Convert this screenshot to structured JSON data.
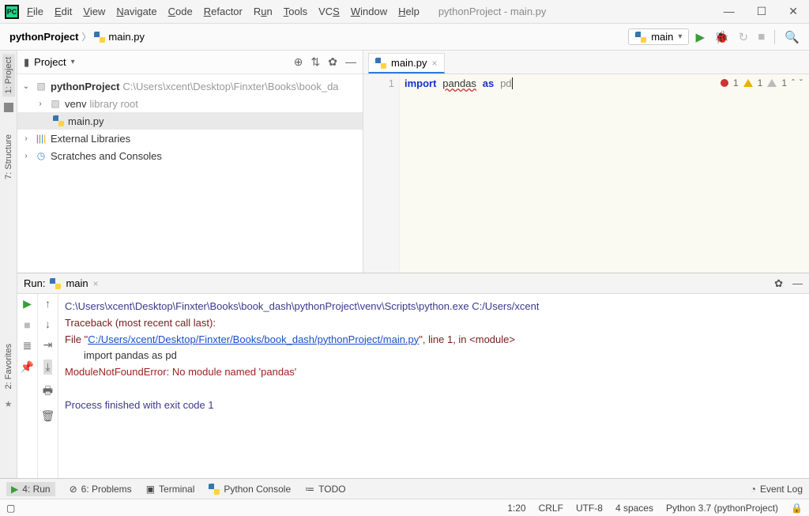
{
  "window": {
    "title": "pythonProject - main.py",
    "menus": [
      "File",
      "Edit",
      "View",
      "Navigate",
      "Code",
      "Refactor",
      "Run",
      "Tools",
      "VCS",
      "Window",
      "Help"
    ]
  },
  "breadcrumb": {
    "project": "pythonProject",
    "file": "main.py"
  },
  "run_config": {
    "label": "main"
  },
  "project_pane": {
    "title": "Project",
    "root": {
      "name": "pythonProject",
      "path": "C:\\Users\\xcent\\Desktop\\Finxter\\Books\\book_da"
    },
    "venv": {
      "name": "venv",
      "badge": "library root"
    },
    "mainfile": "main.py",
    "ext_lib": "External Libraries",
    "scratches": "Scratches and Consoles"
  },
  "editor": {
    "tab": "main.py",
    "line_num": "1",
    "code": {
      "kw_import": "import",
      "mod": "pandas",
      "kw_as": "as",
      "alias": "pd"
    },
    "inspections": {
      "errors": "1",
      "warnings": "1",
      "weak": "1"
    }
  },
  "run_panel": {
    "title": "Run:",
    "tab": "main",
    "l_cmd": "C:\\Users\\xcent\\Desktop\\Finxter\\Books\\book_dash\\pythonProject\\venv\\Scripts\\python.exe C:/Users/xcent",
    "l_trace": "Traceback (most recent call last):",
    "l_file_prefix": "  File \"",
    "l_file_link": "C:/Users/xcent/Desktop/Finxter/Books/book_dash/pythonProject/main.py",
    "l_file_suffix": "\", line 1, in <module>",
    "l_code": "import pandas as pd",
    "l_err": "ModuleNotFoundError: No module named 'pandas'",
    "l_exit": "Process finished with exit code 1"
  },
  "bottom_tools": {
    "run": "4: Run",
    "problems": "6: Problems",
    "terminal": "Terminal",
    "pyconsole": "Python Console",
    "todo": "TODO",
    "eventlog": "Event Log"
  },
  "sidetabs": {
    "project": "1: Project",
    "structure": "7: Structure",
    "favorites": "2: Favorites"
  },
  "status": {
    "pos": "1:20",
    "eol": "CRLF",
    "enc": "UTF-8",
    "indent": "4 spaces",
    "sdk": "Python 3.7 (pythonProject)"
  }
}
